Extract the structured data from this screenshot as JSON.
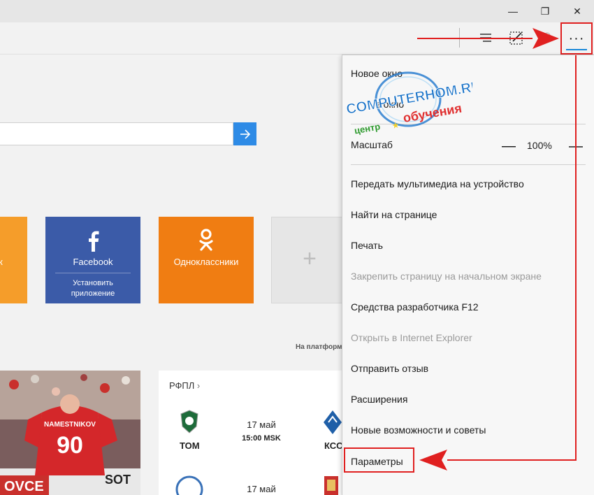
{
  "window": {
    "minimize_glyph": "—",
    "restore_glyph": "❐",
    "close_glyph": "✕"
  },
  "toolbar": {
    "hub_icon": "hub-lines-icon",
    "note_icon": "web-note-icon",
    "share_icon": "share-icon",
    "more_glyph": "···"
  },
  "search": {
    "value": "",
    "go_icon": "arrow-right-icon"
  },
  "tiles": [
    {
      "label": "к",
      "color": "#f59d2a"
    },
    {
      "label": "Facebook",
      "sub": "Установить приложение",
      "color": "#3b5ba8"
    },
    {
      "label": "Одноклассники",
      "color": "#f07d12"
    },
    {
      "label": "+",
      "color": "#e6e6e6"
    }
  ],
  "platform_text": "На платформ",
  "sports": {
    "title": "РФПЛ",
    "matches": [
      {
        "home": "ТОМ",
        "date": "17 май",
        "time": "15:00 MSK",
        "away": "КСС"
      },
      {
        "home": "",
        "date": "17 май",
        "time": "",
        "away": ""
      }
    ]
  },
  "news": {
    "jersey_name": "NAMESTNIKOV",
    "jersey_number": "90",
    "banner": "OVCE",
    "banner2": "SOT"
  },
  "menu": {
    "new_window": "Новое окно",
    "new_inprivate": "е окно",
    "zoom_label": "Масштаб",
    "zoom_value": "100%",
    "items": [
      {
        "label": "Передать мультимедиа на устройство",
        "disabled": false
      },
      {
        "label": "Найти на странице",
        "disabled": false
      },
      {
        "label": "Печать",
        "disabled": false
      },
      {
        "label": "Закрепить страницу на начальном экране",
        "disabled": true
      },
      {
        "label": "Средства разработчика F12",
        "disabled": false
      },
      {
        "label": "Открыть в Internet Explorer",
        "disabled": true
      },
      {
        "label": "Отправить отзыв",
        "disabled": false
      },
      {
        "label": "Расширения",
        "disabled": false
      },
      {
        "label": "Новые возможности и советы",
        "disabled": false
      },
      {
        "label": "Параметры",
        "disabled": false
      }
    ]
  },
  "watermark": {
    "site": "COMPUTERHOM.RU",
    "left_word": "центр",
    "right_word": "обучения"
  },
  "colors": {
    "accent": "#2e8be6",
    "annotation": "#e02020",
    "facebook": "#3b5ba8",
    "ok": "#f07d12"
  }
}
